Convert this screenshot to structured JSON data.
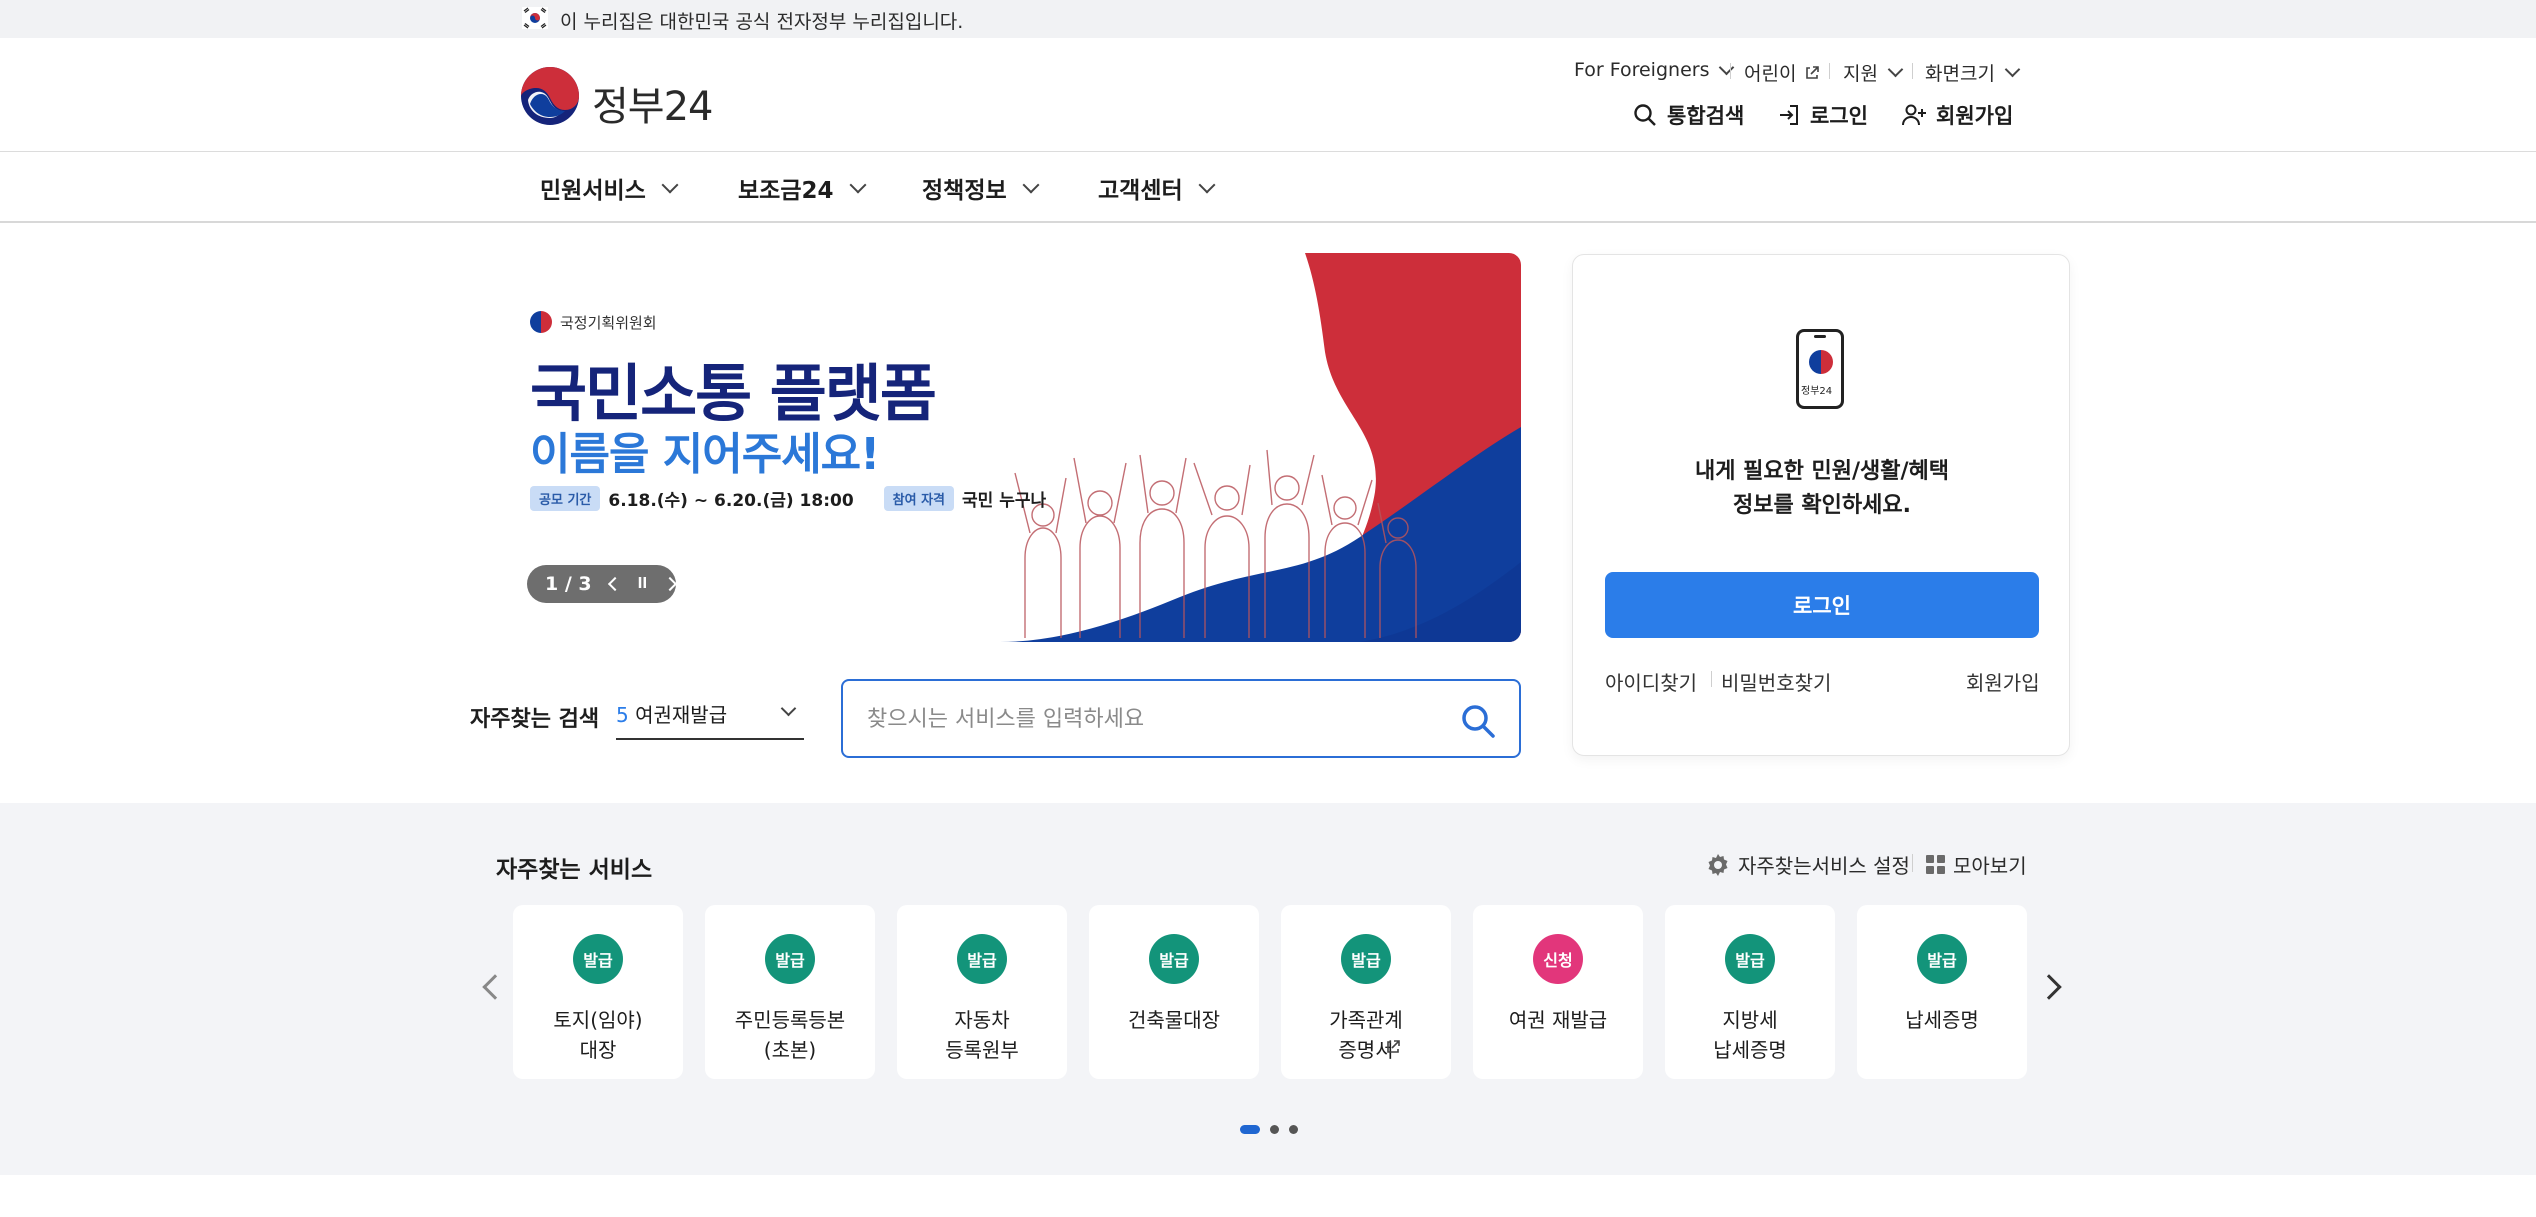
{
  "notice": {
    "text": "이 누리집은 대한민국 공식 전자정부 누리집입니다."
  },
  "header": {
    "logo_text": "정부24",
    "util": {
      "foreigners": "For Foreigners",
      "kids": "어린이",
      "support": "지원",
      "screen": "화면크기"
    },
    "buttons": {
      "search": "통합검색",
      "login": "로그인",
      "signup": "회원가입"
    }
  },
  "gnb": [
    {
      "label": "민원서비스"
    },
    {
      "label": "보조금24"
    },
    {
      "label": "정책정보"
    },
    {
      "label": "고객센터"
    }
  ],
  "banner": {
    "org": "국정기획위원회",
    "title1": "국민소통 플랫폼",
    "title2": "이름을 지어주세요!",
    "period_tag": "공모 기간",
    "period": "6.18.(수) ~ 6.20.(금) 18:00",
    "target_tag": "참여 자격",
    "target": "국민 누구나",
    "pager": "1 / 3",
    "colors": {
      "red": "#cd2e3a",
      "blue": "#0f3e9d",
      "navy": "#15247a"
    }
  },
  "login_card": {
    "phone_label": "정부24",
    "message_line1": "내게 필요한 민원/생활/혜택",
    "message_line2": "정보를 확인하세요.",
    "login_button": "로그인",
    "find_id": "아이디찾기",
    "find_pw": "비밀번호찾기",
    "signup": "회원가입"
  },
  "frequent_search": {
    "label": "자주찾는 검색",
    "selected_rank": "5",
    "selected_value": "여권재발급",
    "placeholder": "찾으시는 서비스를 입력하세요"
  },
  "frequent_services": {
    "title": "자주찾는 서비스",
    "settings": "자주찾는서비스 설정",
    "view_all": "모아보기",
    "items": [
      {
        "badge": "발급",
        "name": "토지(임야)\n대장"
      },
      {
        "badge": "발급",
        "name": "주민등록등본\n(초본)"
      },
      {
        "badge": "발급",
        "name": "자동차\n등록원부"
      },
      {
        "badge": "발급",
        "name": "건축물대장"
      },
      {
        "badge": "발급",
        "name": "가족관계\n증명서"
      },
      {
        "badge": "신청",
        "name": "여권 재발급"
      },
      {
        "badge": "발급",
        "name": "지방세\n납세증명"
      },
      {
        "badge": "발급",
        "name": "납세증명"
      }
    ],
    "page_count": 3,
    "active_page": 1
  }
}
